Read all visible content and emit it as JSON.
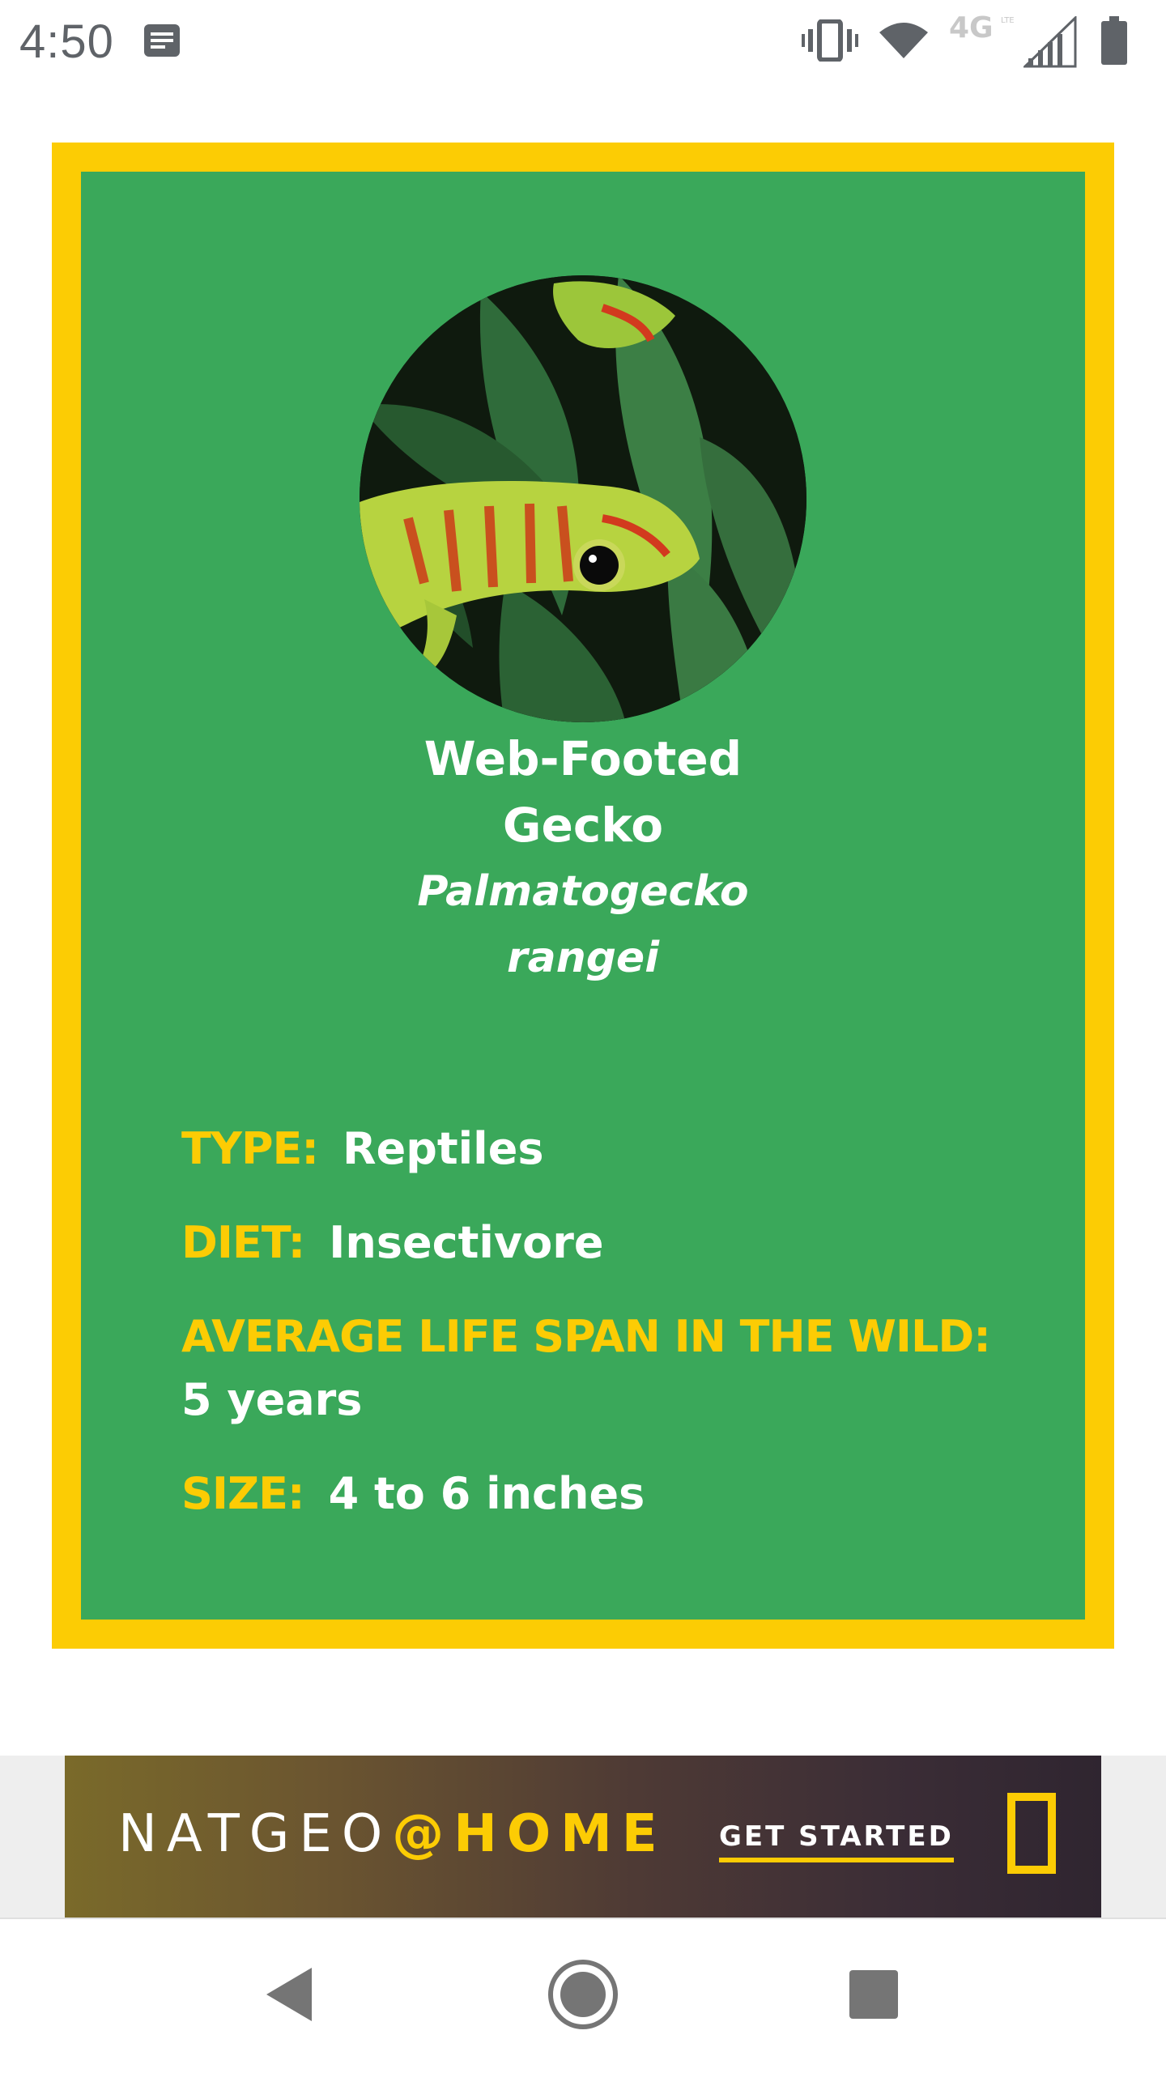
{
  "status_bar": {
    "time": "4:50",
    "network_label": "4G",
    "icons": [
      "notification-icon",
      "vibrate-icon",
      "wifi-icon",
      "lte-icon",
      "signal-icon",
      "battery-icon"
    ]
  },
  "animal": {
    "common_name_line1": "Web-Footed",
    "common_name_line2": "Gecko",
    "scientific_name_line1": "Palmatogecko",
    "scientific_name_line2": "rangei",
    "photo_icon": "gecko-photo",
    "facts": [
      {
        "label": "TYPE:",
        "value": "Reptiles"
      },
      {
        "label": "DIET:",
        "value": "Insectivore"
      },
      {
        "label": "AVERAGE LIFE SPAN IN THE WILD:",
        "value": "5 years"
      },
      {
        "label": "SIZE:",
        "value": "4 to 6 inches"
      }
    ]
  },
  "ad": {
    "brand_part1": "NATGEO",
    "brand_at": "@",
    "brand_part2": "HOME",
    "cta": "GET STARTED"
  },
  "nav": {
    "back_icon": "back-triangle-icon",
    "home_icon": "home-circle-icon",
    "recents_icon": "recents-square-icon"
  },
  "colors": {
    "card_border": "#fccc04",
    "card_fill": "#3aa85a",
    "label_yellow": "#fccc04",
    "text_white": "#ffffff"
  }
}
